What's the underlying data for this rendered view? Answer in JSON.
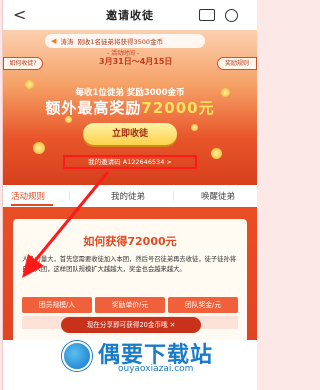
{
  "header": {
    "title": "邀请收徒",
    "back_glyph": "<"
  },
  "hero": {
    "ticker_user": "涛涛",
    "ticker_text": "刚收1名徒弟将获得3500金币",
    "time_label": "- 活动时间 -",
    "time_value": "3月31日～4月15日",
    "left_button": "如何收徒?",
    "right_button": "奖励规则",
    "subtitle": "每收1位徒弟 奖励3000金币",
    "headline_prefix": "额外最高奖励",
    "headline_amount": "72000元",
    "invite_button": "立即收徒",
    "invite_code": "我的邀请码 A122646534 >"
  },
  "tabs": [
    {
      "label": "活动规则",
      "active": true
    },
    {
      "label": "我的徒弟",
      "active": false
    },
    {
      "label": "唤醒徒弟",
      "active": false
    }
  ],
  "card": {
    "title": "如何获得72000元",
    "body": "人多力量大，首先您需要收徒加入本团，然后号召徒弟再去收徒，徒子徒孙将自动入团，这样团队规模扩大越越大，奖金也会越来越大。",
    "columns": [
      "团员规模/人",
      "奖励单价/元",
      "团队奖金/元"
    ]
  },
  "toast": "现在分享即可获得20金币哦 ✕",
  "watermark": {
    "text": "偶要下载站",
    "url": "ouyaoxiazai.com"
  },
  "colors": {
    "accent": "#e04c26",
    "gold": "#ffe35a",
    "highlight_box": "#ff1a1a"
  }
}
